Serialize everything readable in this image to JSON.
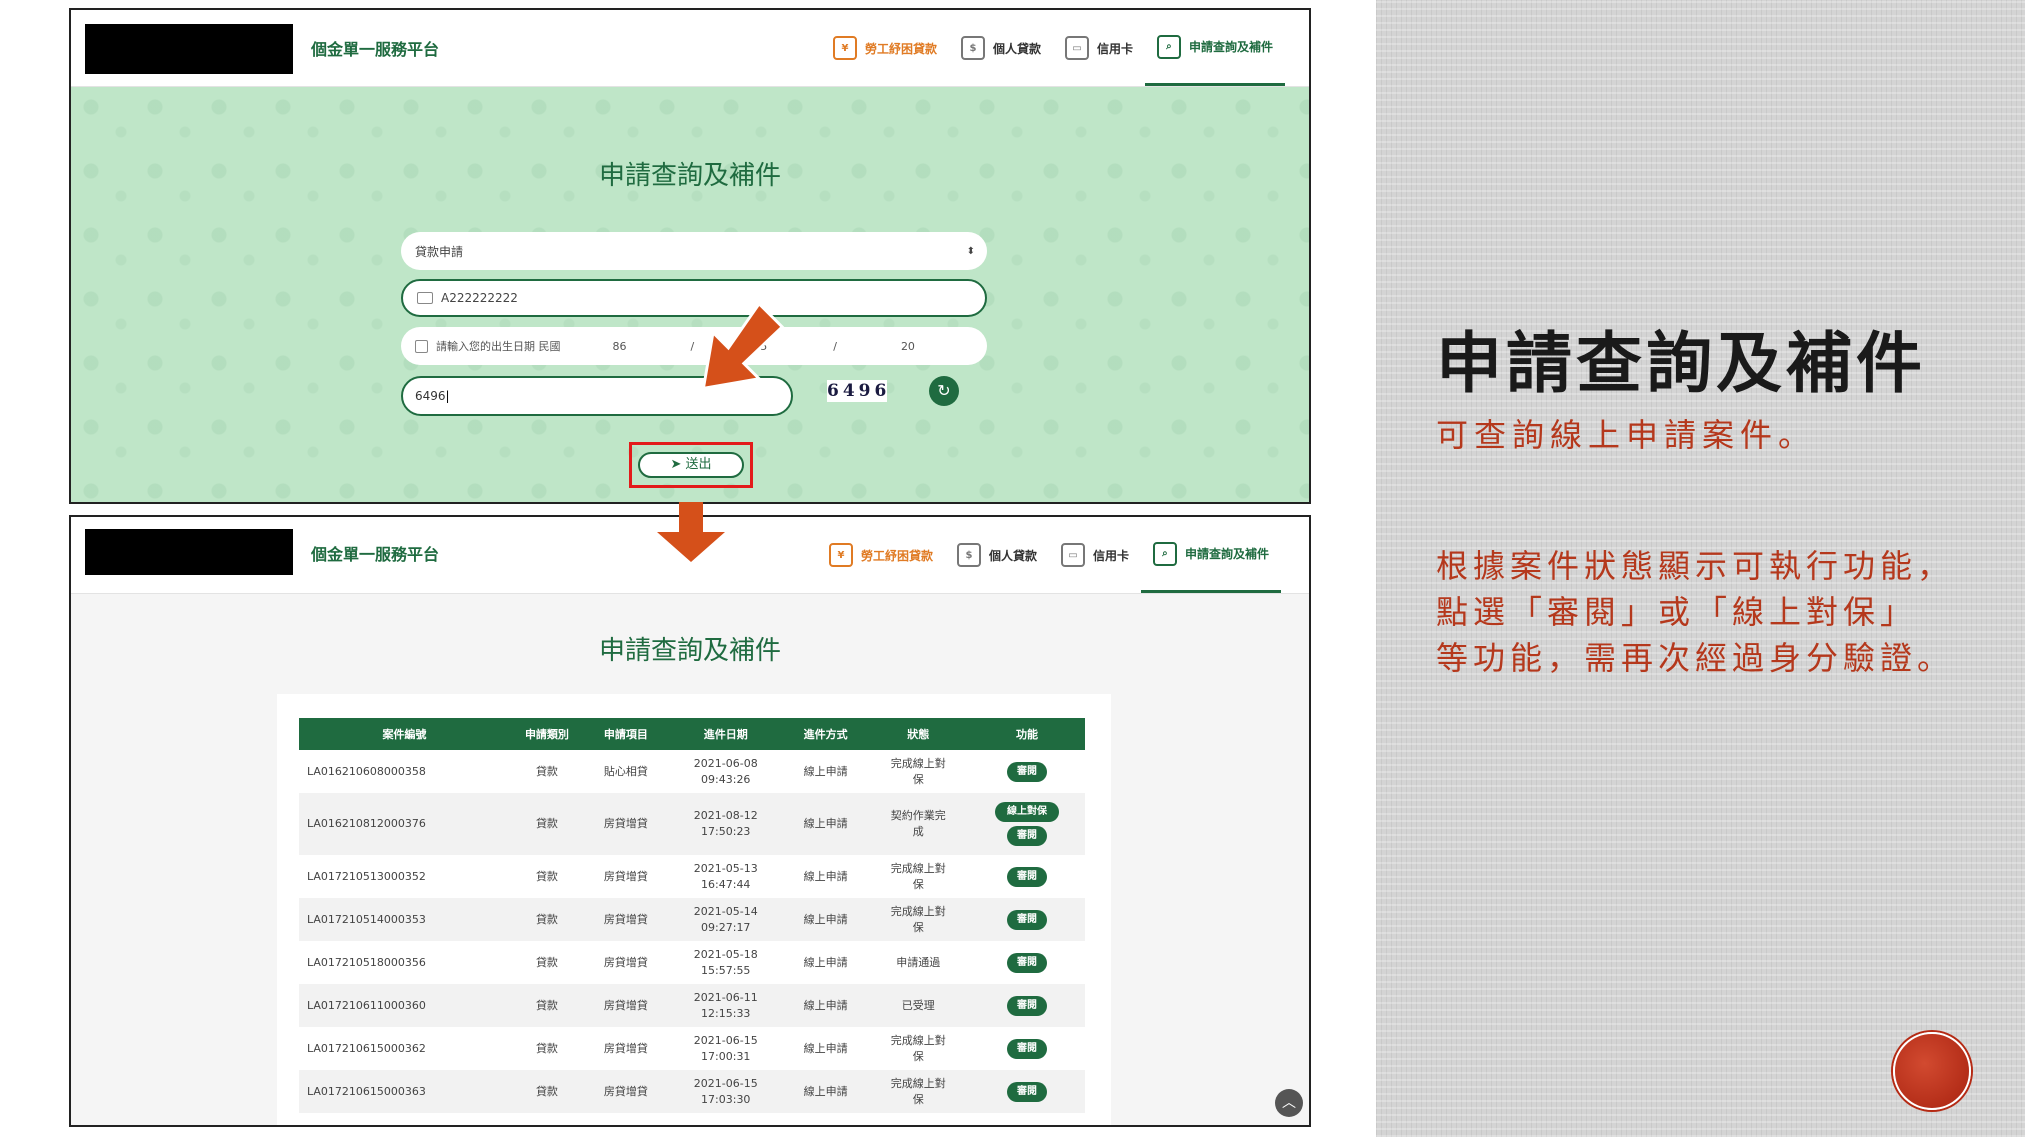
{
  "site_name": "個金單一服務平台",
  "nav": [
    "勞工紓困貸款",
    "個人貸款",
    "信用卡",
    "申請查詢及補件"
  ],
  "form": {
    "title": "申請查詢及補件",
    "select_value": "貸款申請",
    "id_value": "A222222222",
    "dob_label": "請輸入您的出生日期 民國",
    "dob_year": "86",
    "dob_month": "5",
    "dob_day": "20",
    "captcha_input": "6496",
    "captcha_image_text": "6496",
    "submit_label": "送出"
  },
  "list": {
    "title": "申請查詢及補件",
    "columns": [
      "案件編號",
      "申請類別",
      "申請項目",
      "進件日期",
      "進件方式",
      "狀態",
      "功能"
    ],
    "rows": [
      {
        "id": "LA016210608000358",
        "cat": "貸款",
        "item": "貼心相貸",
        "date": "2021-06-08",
        "time": "09:43:26",
        "method": "線上申請",
        "status1": "完成線上對",
        "status2": "保",
        "action": "審閱",
        "action2": ""
      },
      {
        "id": "LA016210812000376",
        "cat": "貸款",
        "item": "房貸增貸",
        "date": "2021-08-12",
        "time": "17:50:23",
        "method": "線上申請",
        "status1": "契約作業完",
        "status2": "成",
        "action": "線上對保",
        "action2": "審閱"
      },
      {
        "id": "LA017210513000352",
        "cat": "貸款",
        "item": "房貸增貸",
        "date": "2021-05-13",
        "time": "16:47:44",
        "method": "線上申請",
        "status1": "完成線上對",
        "status2": "保",
        "action": "審閱",
        "action2": ""
      },
      {
        "id": "LA017210514000353",
        "cat": "貸款",
        "item": "房貸增貸",
        "date": "2021-05-14",
        "time": "09:27:17",
        "method": "線上申請",
        "status1": "完成線上對",
        "status2": "保",
        "action": "審閱",
        "action2": ""
      },
      {
        "id": "LA017210518000356",
        "cat": "貸款",
        "item": "房貸增貸",
        "date": "2021-05-18",
        "time": "15:57:55",
        "method": "線上申請",
        "status1": "申請通過",
        "status2": "",
        "action": "審閱",
        "action2": ""
      },
      {
        "id": "LA017210611000360",
        "cat": "貸款",
        "item": "房貸增貸",
        "date": "2021-06-11",
        "time": "12:15:33",
        "method": "線上申請",
        "status1": "已受理",
        "status2": "",
        "action": "審閱",
        "action2": ""
      },
      {
        "id": "LA017210615000362",
        "cat": "貸款",
        "item": "房貸增貸",
        "date": "2021-06-15",
        "time": "17:00:31",
        "method": "線上申請",
        "status1": "完成線上對",
        "status2": "保",
        "action": "審閱",
        "action2": ""
      },
      {
        "id": "LA017210615000363",
        "cat": "貸款",
        "item": "房貸增貸",
        "date": "2021-06-15",
        "time": "17:03:30",
        "method": "線上申請",
        "status1": "完成線上對",
        "status2": "保",
        "action": "審閱",
        "action2": ""
      }
    ]
  },
  "slide": {
    "title": "申請查詢及補件",
    "subtitle": "可查詢線上申請案件。",
    "desc_lines": [
      "根據案件狀態顯示可執行功能，",
      "點選「審閱」或「線上對保」",
      "等功能，需再次經過身分驗證。"
    ]
  },
  "colors": {
    "brand_green": "#1f6b40",
    "accent_orange": "#e07b24",
    "highlight_red": "#e31b1b",
    "arrow_orange": "#d5501a",
    "slide_text_red": "#b5381c"
  }
}
